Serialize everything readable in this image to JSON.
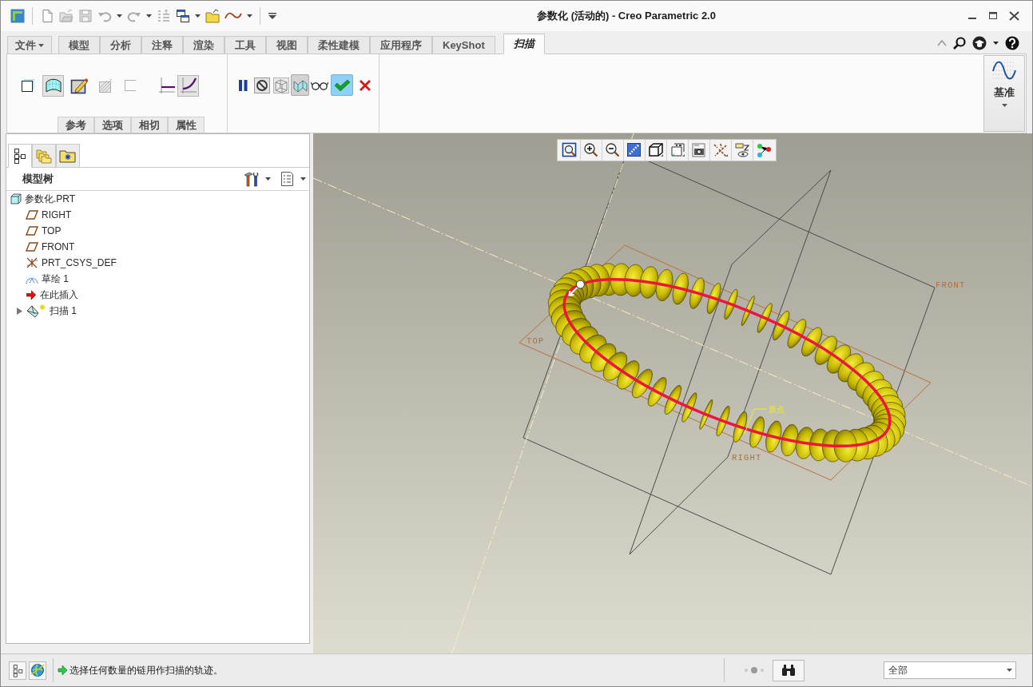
{
  "window": {
    "title": "参数化 (活动的) - Creo Parametric 2.0"
  },
  "quick_access_toolbar": [
    {
      "kind": "app",
      "disabled": false
    },
    {
      "kind": "new",
      "disabled": false
    },
    {
      "kind": "open",
      "disabled": true
    },
    {
      "kind": "save",
      "disabled": true
    },
    {
      "kind": "undo",
      "disabled": true
    },
    {
      "kind": "redo",
      "disabled": true
    },
    {
      "kind": "regenerate",
      "disabled": true
    },
    {
      "kind": "windows",
      "disabled": false
    },
    {
      "kind": "close",
      "disabled": false
    },
    {
      "kind": "curve",
      "disabled": false
    },
    {
      "kind": "customize",
      "disabled": false
    }
  ],
  "ribbon": {
    "tabs": [
      {
        "label": "文件",
        "kind": "menu",
        "selected": false
      },
      {
        "label": "模型",
        "kind": "tab",
        "selected": false
      },
      {
        "label": "分析",
        "kind": "tab",
        "selected": false
      },
      {
        "label": "注释",
        "kind": "tab",
        "selected": false
      },
      {
        "label": "渲染",
        "kind": "tab",
        "selected": false
      },
      {
        "label": "工具",
        "kind": "tab",
        "selected": false
      },
      {
        "label": "视图",
        "kind": "tab",
        "selected": false
      },
      {
        "label": "柔性建模",
        "kind": "tab",
        "selected": false
      },
      {
        "label": "应用程序",
        "kind": "tab",
        "selected": false
      },
      {
        "label": "KeyShot",
        "kind": "tab",
        "selected": false
      },
      {
        "label": "扫描",
        "kind": "dashboard",
        "selected": true
      }
    ],
    "sweep_type_buttons": [
      {
        "kind": "solid",
        "pressed": false,
        "disabled": false
      },
      {
        "kind": "surface",
        "pressed": true,
        "disabled": false
      },
      {
        "kind": "sketch",
        "pressed": false,
        "disabled": false
      },
      {
        "kind": "remove-material",
        "pressed": false,
        "disabled": true
      },
      {
        "kind": "thicken",
        "pressed": false,
        "disabled": true
      },
      {
        "kind": "constant",
        "pressed": false,
        "disabled": false
      },
      {
        "kind": "variable",
        "pressed": true,
        "disabled": false
      }
    ],
    "panel_tabs": [
      "参考",
      "选项",
      "相切",
      "属性"
    ],
    "control_buttons": [
      {
        "kind": "pause",
        "pressed": false
      },
      {
        "kind": "no-preview",
        "pressed": false
      },
      {
        "kind": "geometry-preview",
        "pressed": false
      },
      {
        "kind": "feature-preview",
        "pressed": true
      },
      {
        "kind": "verify",
        "pressed": false
      },
      {
        "kind": "ok",
        "pressed": true
      },
      {
        "kind": "cancel",
        "pressed": false
      }
    ],
    "datum_button": {
      "label": "基准"
    }
  },
  "model_tree": {
    "tabs": [
      {
        "kind": "tree",
        "selected": true
      },
      {
        "kind": "folders",
        "selected": false
      },
      {
        "kind": "favorites",
        "selected": false
      }
    ],
    "title": "模型树",
    "items": [
      {
        "label": "参数化.PRT",
        "kind": "part",
        "children": [
          {
            "label": "RIGHT",
            "kind": "plane"
          },
          {
            "label": "TOP",
            "kind": "plane"
          },
          {
            "label": "FRONT",
            "kind": "plane"
          },
          {
            "label": "PRT_CSYS_DEF",
            "kind": "csys"
          },
          {
            "label": "草绘 1",
            "kind": "sketch"
          },
          {
            "label": "在此插入",
            "kind": "insert"
          },
          {
            "label": "扫描 1",
            "kind": "sweep",
            "expanded": false
          }
        ]
      }
    ]
  },
  "viewport": {
    "datum_planes": [
      {
        "label": "FRONT"
      },
      {
        "label": "TOP"
      },
      {
        "label": "RIGHT"
      }
    ],
    "annotation": "原点"
  },
  "status_bar": {
    "message": "选择任何数量的链用作扫描的轨迹。",
    "filter": {
      "value": "全部"
    }
  }
}
